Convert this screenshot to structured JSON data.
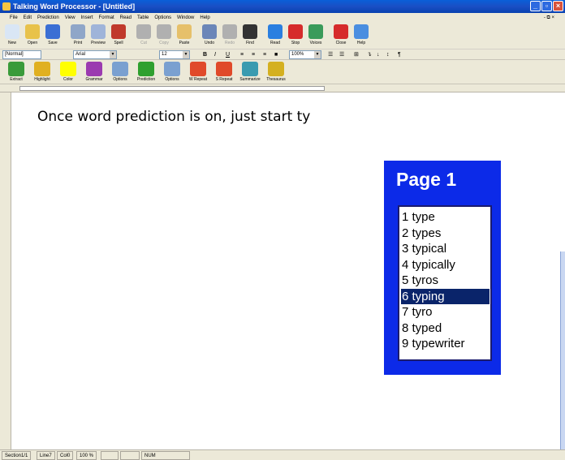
{
  "window": {
    "title": "Talking Word Processor - [Untitled]"
  },
  "menu": [
    "File",
    "Edit",
    "Prediction",
    "View",
    "Insert",
    "Format",
    "Read",
    "Table",
    "Options",
    "Window",
    "Help"
  ],
  "toolbar_main": [
    {
      "label": "New",
      "icon": "new-document-icon",
      "color": "#d9e6f5"
    },
    {
      "label": "Open",
      "icon": "open-folder-icon",
      "color": "#e8c24a"
    },
    {
      "label": "Save",
      "icon": "save-disk-icon",
      "color": "#3b6fd4"
    },
    {
      "label": "Print",
      "icon": "print-icon",
      "color": "#8fa6c8"
    },
    {
      "label": "Preview",
      "icon": "preview-icon",
      "color": "#9fb4d9"
    },
    {
      "label": "Spell",
      "icon": "spell-check-icon",
      "color": "#c0392b"
    },
    {
      "label": "Cut",
      "icon": "cut-icon",
      "color": "#b0b0b0"
    },
    {
      "label": "Copy",
      "icon": "copy-icon",
      "color": "#b0b0b0"
    },
    {
      "label": "Paste",
      "icon": "paste-icon",
      "color": "#e6c06a"
    },
    {
      "label": "Undo",
      "icon": "undo-icon",
      "color": "#6b86b8"
    },
    {
      "label": "Redo",
      "icon": "redo-icon",
      "color": "#b0b0b0"
    },
    {
      "label": "Find",
      "icon": "find-binoculars-icon",
      "color": "#333333"
    },
    {
      "label": "Read",
      "icon": "read-icon",
      "color": "#2a7fe0"
    },
    {
      "label": "Stop",
      "icon": "stop-icon",
      "color": "#d62b2b"
    },
    {
      "label": "Voices",
      "icon": "voices-icon",
      "color": "#3a9b5a"
    },
    {
      "label": "Close",
      "icon": "close-icon",
      "color": "#d62b2b"
    },
    {
      "label": "Help",
      "icon": "help-icon",
      "color": "#4a8ee0"
    }
  ],
  "format_bar": {
    "style": "[Normal]",
    "font": "Arial",
    "size": "12",
    "zoom": "100%"
  },
  "toolbar_tools": [
    {
      "label": "Extract",
      "icon": "extract-icon",
      "color": "#3a9b3a"
    },
    {
      "label": "Highlight",
      "icon": "highlight-icon",
      "color": "#e0b020"
    },
    {
      "label": "Color",
      "icon": "color-swatch-icon",
      "color": "#ffff00"
    },
    {
      "label": "Grammar",
      "icon": "grammar-icon",
      "color": "#9b3ab0"
    },
    {
      "label": "Options",
      "icon": "options-icon",
      "color": "#7aa0d0"
    },
    {
      "label": "Prediction",
      "icon": "prediction-check-icon",
      "color": "#2fa02f"
    },
    {
      "label": "Options",
      "icon": "options-icon",
      "color": "#7aa0d0"
    },
    {
      "label": "W Repeat",
      "icon": "word-repeat-icon",
      "color": "#e04a2a"
    },
    {
      "label": "S Repeat",
      "icon": "sentence-repeat-icon",
      "color": "#e04a2a"
    },
    {
      "label": "Summarize",
      "icon": "summarize-icon",
      "color": "#3a9bb0"
    },
    {
      "label": "Thesaurus",
      "icon": "thesaurus-icon",
      "color": "#d4b020"
    }
  ],
  "document": {
    "text": "Once word prediction is on, just start ty"
  },
  "prediction": {
    "title": "Page 1",
    "selected_index": 5,
    "items": [
      "1 type",
      "2 types",
      "3 typical",
      "4 typically",
      "5 tyros",
      "6 typing",
      "7 tyro",
      "8 typed",
      "9 typewriter"
    ]
  },
  "status": {
    "section": "Section1/1",
    "line": "Line7",
    "col": "Col0",
    "zoom": "100 %",
    "num": "NUM"
  }
}
